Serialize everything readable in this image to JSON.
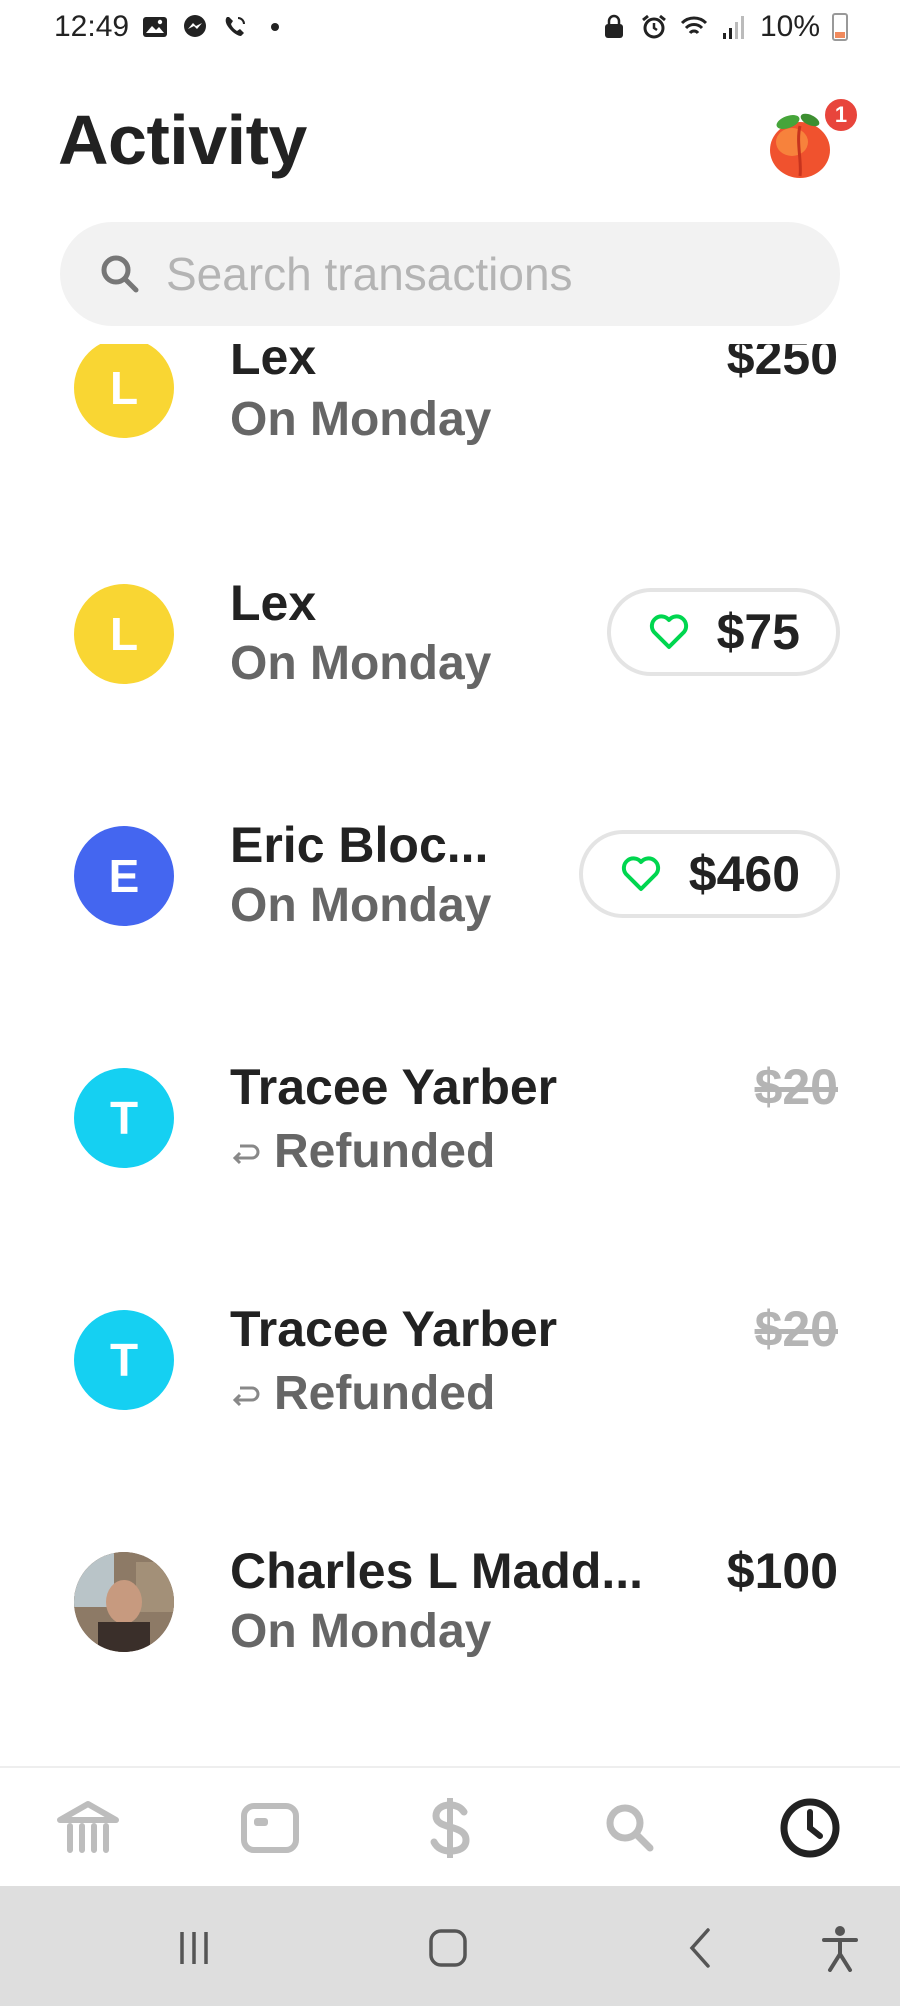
{
  "status_bar": {
    "time": "12:49",
    "battery": "10%"
  },
  "header": {
    "title": "Activity",
    "notification_count": "1"
  },
  "search": {
    "placeholder": "Search transactions"
  },
  "transactions": [
    {
      "avatar_letter": "L",
      "avatar_color": "#f9d633",
      "name": "Lex",
      "sub": "On Monday",
      "amount": "$250",
      "style": "plain"
    },
    {
      "avatar_letter": "L",
      "avatar_color": "#f9d633",
      "name": "Lex",
      "sub": "On Monday",
      "amount": "$75",
      "style": "pill"
    },
    {
      "avatar_letter": "E",
      "avatar_color": "#4466f0",
      "name": "Eric Bloc...",
      "sub": "On Monday",
      "amount": "$460",
      "style": "pill"
    },
    {
      "avatar_letter": "T",
      "avatar_color": "#15d0f2",
      "name": "Tracee Yarber",
      "sub": "Refunded",
      "amount": "$20",
      "style": "struck"
    },
    {
      "avatar_letter": "T",
      "avatar_color": "#15d0f2",
      "name": "Tracee Yarber",
      "sub": "Refunded",
      "amount": "$20",
      "style": "struck"
    },
    {
      "avatar_letter": "",
      "avatar_color": "#7a5a48",
      "name": "Charles L Madd...",
      "sub": "On Monday",
      "amount": "$100",
      "style": "plain"
    }
  ],
  "bottom_nav": [
    {
      "icon": "bank-icon",
      "active": false
    },
    {
      "icon": "card-icon",
      "active": false
    },
    {
      "icon": "dollar-icon",
      "active": false
    },
    {
      "icon": "search-icon",
      "active": false
    },
    {
      "icon": "clock-icon",
      "active": true
    }
  ],
  "colors": {
    "accent_green": "#00d64f",
    "text_primary": "#222222",
    "text_secondary": "#666666",
    "nav_inactive": "#bdbdbd"
  }
}
